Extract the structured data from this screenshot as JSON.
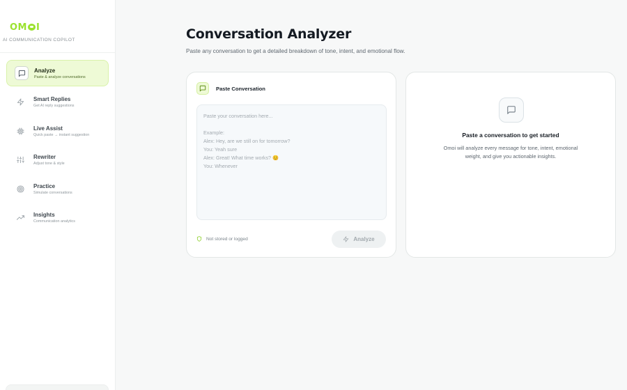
{
  "brand": {
    "logo_left": "OM",
    "logo_right": "I",
    "tagline": "AI COMMUNICATION COPILOT"
  },
  "nav": {
    "items": [
      {
        "title": "Analyze",
        "subtitle": "Paste & analyze conversations",
        "icon": "message-square-icon",
        "active": true
      },
      {
        "title": "Smart Replies",
        "subtitle": "Get AI reply suggestions",
        "icon": "lightning-icon",
        "active": false
      },
      {
        "title": "Live Assist",
        "subtitle": "Quick paste → instant suggestion",
        "icon": "cpu-icon",
        "active": false
      },
      {
        "title": "Rewriter",
        "subtitle": "Adjust tone & style",
        "icon": "sliders-icon",
        "active": false
      },
      {
        "title": "Practice",
        "subtitle": "Simulate conversations",
        "icon": "target-icon",
        "active": false
      },
      {
        "title": "Insights",
        "subtitle": "Communication analytics",
        "icon": "trending-up-icon",
        "active": false
      }
    ]
  },
  "header": {
    "title": "Conversation Analyzer",
    "subtitle": "Paste any conversation to get a detailed breakdown of tone, intent, and emotional flow."
  },
  "input_card": {
    "label": "Paste Conversation",
    "placeholder": "Paste your conversation here...\n\nExample:\nAlex: Hey, are we still on for tomorrow?\nYou: Yeah sure\nAlex: Great! What time works? 😊\nYou: Whenever",
    "value": "",
    "privacy_note": "Not stored or logged",
    "analyze_label": "Analyze"
  },
  "result_card": {
    "title": "Paste a conversation to get started",
    "description": "Omoi will analyze every message for tone, intent, emotional weight, and give you actionable insights."
  },
  "colors": {
    "accent": "#9be22f",
    "active_bg": "#eefad6",
    "background": "#f7f8f8"
  }
}
